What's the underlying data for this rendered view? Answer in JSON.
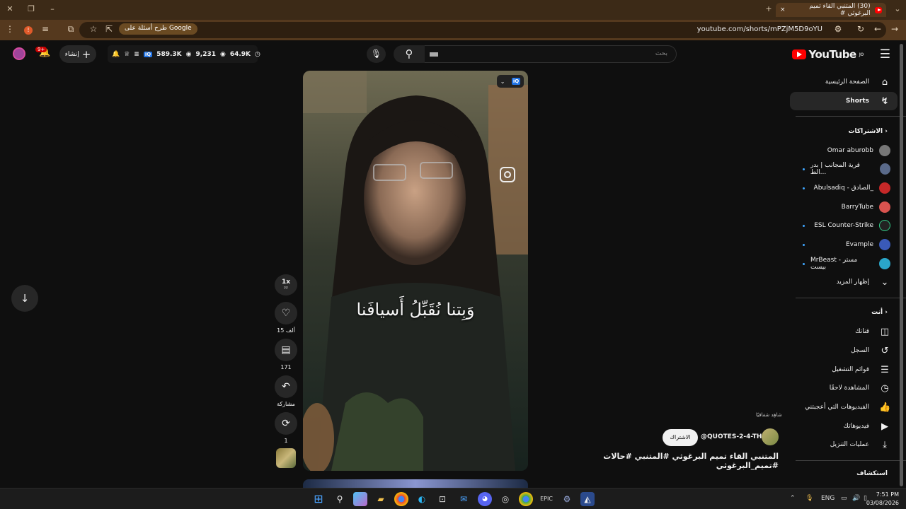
{
  "browser": {
    "tab_title": "(30) المتنبي القاء تميم البرغوثي #",
    "url": "youtube.com/shorts/mPZjM5D9oYU",
    "google_chip": "طرح أسئلة على Google",
    "new_tab": "+",
    "close_tab": "×"
  },
  "header": {
    "logo_text": "YouTube",
    "logo_region": "JO",
    "search_placeholder": "بحث",
    "create_label": "إنشاء",
    "notification_count": "9+",
    "stats": {
      "views": "589.3K",
      "likes": "9,231",
      "watch": "64.9K"
    }
  },
  "sidebar": {
    "main": [
      {
        "label": "الصفحة الرئيسية",
        "icon": "home-icon"
      },
      {
        "label": "Shorts",
        "icon": "shorts-icon"
      }
    ],
    "subscriptions_title": "الاشتراكات",
    "subscriptions": [
      {
        "label": "Omar aburobb",
        "color": "#777777",
        "dot": false
      },
      {
        "label": "قرية المجانب | بدر الط...",
        "color": "#5a6a8a",
        "dot": true
      },
      {
        "label": "Abulsadiq - الصادق_",
        "color": "#c62828",
        "dot": true
      },
      {
        "label": "BarryTube",
        "color": "#d9534f",
        "dot": false
      },
      {
        "label": "ESL Counter-Strike",
        "color": "#222222",
        "dot": true
      },
      {
        "label": "Evample",
        "color": "#3a5ab8",
        "dot": true
      },
      {
        "label": "MrBeast - مستر بيست",
        "color": "#2aa6c9",
        "dot": true
      }
    ],
    "show_more": "إظهار المزيد",
    "you_title": "أنت",
    "you_items": [
      {
        "label": "قناتك",
        "icon": "your-channel-icon"
      },
      {
        "label": "السجل",
        "icon": "history-icon"
      },
      {
        "label": "قوائم التشغيل",
        "icon": "playlists-icon"
      },
      {
        "label": "المشاهدة لاحقًا",
        "icon": "watch-later-icon"
      },
      {
        "label": "الفيديوهات التي أعجبتني",
        "icon": "liked-icon"
      },
      {
        "label": "فيديوهاتك",
        "icon": "your-videos-icon"
      },
      {
        "label": "عمليات التنزيل",
        "icon": "downloads-icon"
      }
    ],
    "explore_title": "استكشاف"
  },
  "short": {
    "caption": "وَبِتنا نُقَبِّلُ أَسيافَنا",
    "speed": "1x",
    "speed_sub": "pp",
    "likes": "15 ألف",
    "comments": "171",
    "share": "مشاركة",
    "remix": "1",
    "hint": "شاهِد شفافيًا",
    "subscribe": "الاشتراك",
    "channel": "@QUOTES-2-4-THD",
    "title": "المتنبي القاء تميم البرغوثي      #المتنبي #حالات #تميم_البرغوثي"
  },
  "taskbar": {
    "lang": "ENG",
    "time": "7:51 PM",
    "date": "03/08/2026"
  }
}
